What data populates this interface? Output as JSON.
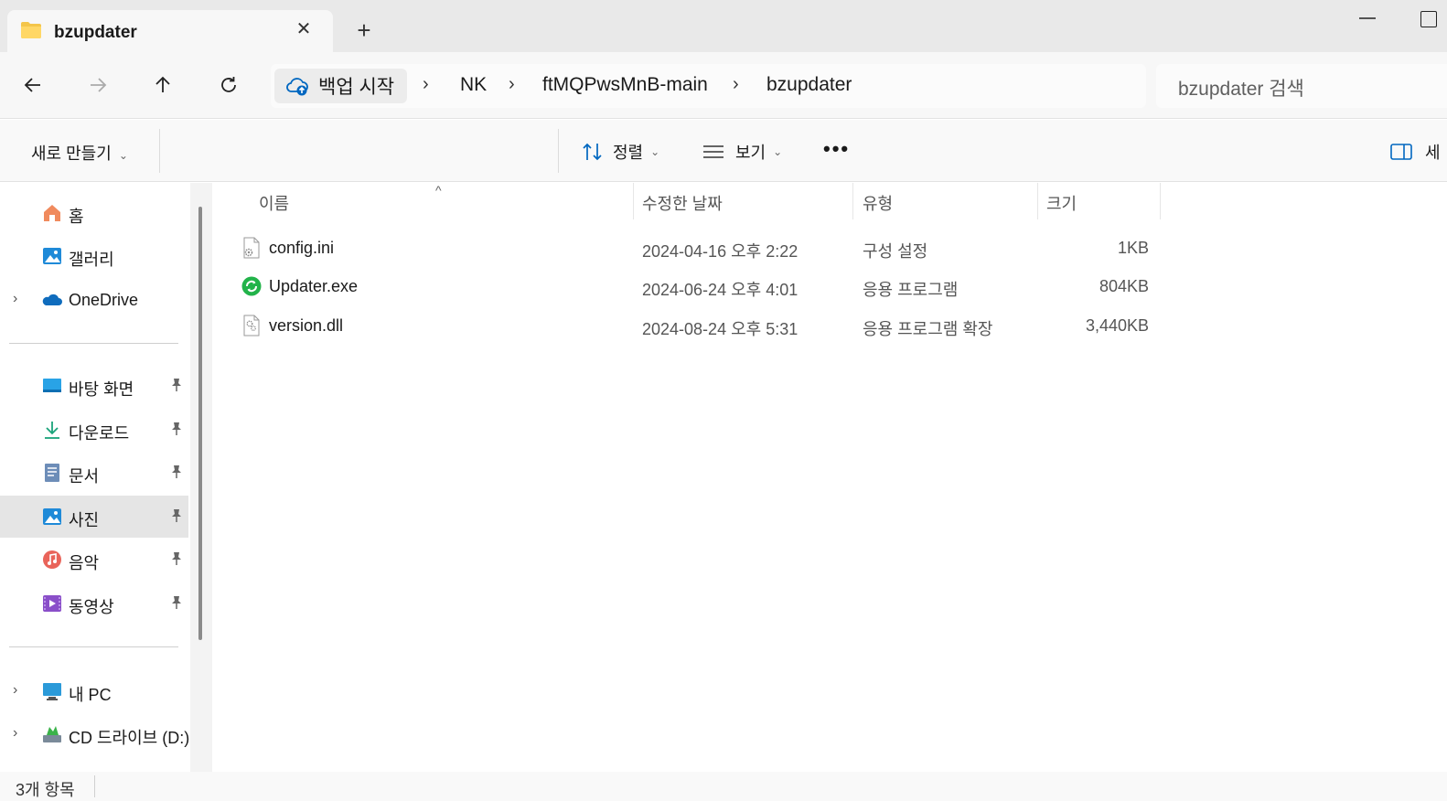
{
  "tab": {
    "title": "bzupdater",
    "close": "✕",
    "new_tab": "+"
  },
  "nav": {
    "back": "back",
    "forward": "forward",
    "up": "up",
    "refresh": "refresh"
  },
  "address": {
    "home_label": "백업 시작",
    "crumbs": [
      "NK",
      "ftMQPwsMnB-main",
      "bzupdater"
    ],
    "separator": "›"
  },
  "search": {
    "placeholder": "bzupdater 검색"
  },
  "commands": {
    "new": "새로 만들기",
    "sort": "정렬",
    "view": "보기",
    "more": "•••",
    "details": "세"
  },
  "sidebar": {
    "items": [
      {
        "label": "홈",
        "icon": "home-icon"
      },
      {
        "label": "갤러리",
        "icon": "gallery-icon"
      },
      {
        "label": "OneDrive",
        "icon": "onedrive-icon",
        "expandable": true
      },
      {
        "label": "바탕 화면",
        "icon": "desktop-icon",
        "pinned": true
      },
      {
        "label": "다운로드",
        "icon": "download-icon",
        "pinned": true
      },
      {
        "label": "문서",
        "icon": "document-icon",
        "pinned": true
      },
      {
        "label": "사진",
        "icon": "pictures-icon",
        "pinned": true,
        "selected": true
      },
      {
        "label": "음악",
        "icon": "music-icon",
        "pinned": true
      },
      {
        "label": "동영상",
        "icon": "video-icon",
        "pinned": true
      },
      {
        "label": "내 PC",
        "icon": "pc-icon",
        "expandable": true
      },
      {
        "label": "CD 드라이브 (D:)",
        "icon": "cd-drive-icon",
        "expandable": true
      }
    ]
  },
  "columns": {
    "name": "이름",
    "modified": "수정한 날짜",
    "type": "유형",
    "size": "크기"
  },
  "files": [
    {
      "name": "config.ini",
      "modified": "2024-04-16 오후 2:22",
      "type": "구성 설정",
      "size": "1KB",
      "icon": "settings-file-icon"
    },
    {
      "name": "Updater.exe",
      "modified": "2024-06-24 오후 4:01",
      "type": "응용 프로그램",
      "size": "804KB",
      "icon": "updater-app-icon"
    },
    {
      "name": "version.dll",
      "modified": "2024-08-24 오후 5:31",
      "type": "응용 프로그램 확장",
      "size": "3,440KB",
      "icon": "dll-file-icon"
    }
  ],
  "status": {
    "item_count": "3개 항목"
  },
  "colors": {
    "accent": "#0067c0",
    "selected_bg": "#e5e5e5",
    "titlebar_bg": "#e9e9e9"
  }
}
